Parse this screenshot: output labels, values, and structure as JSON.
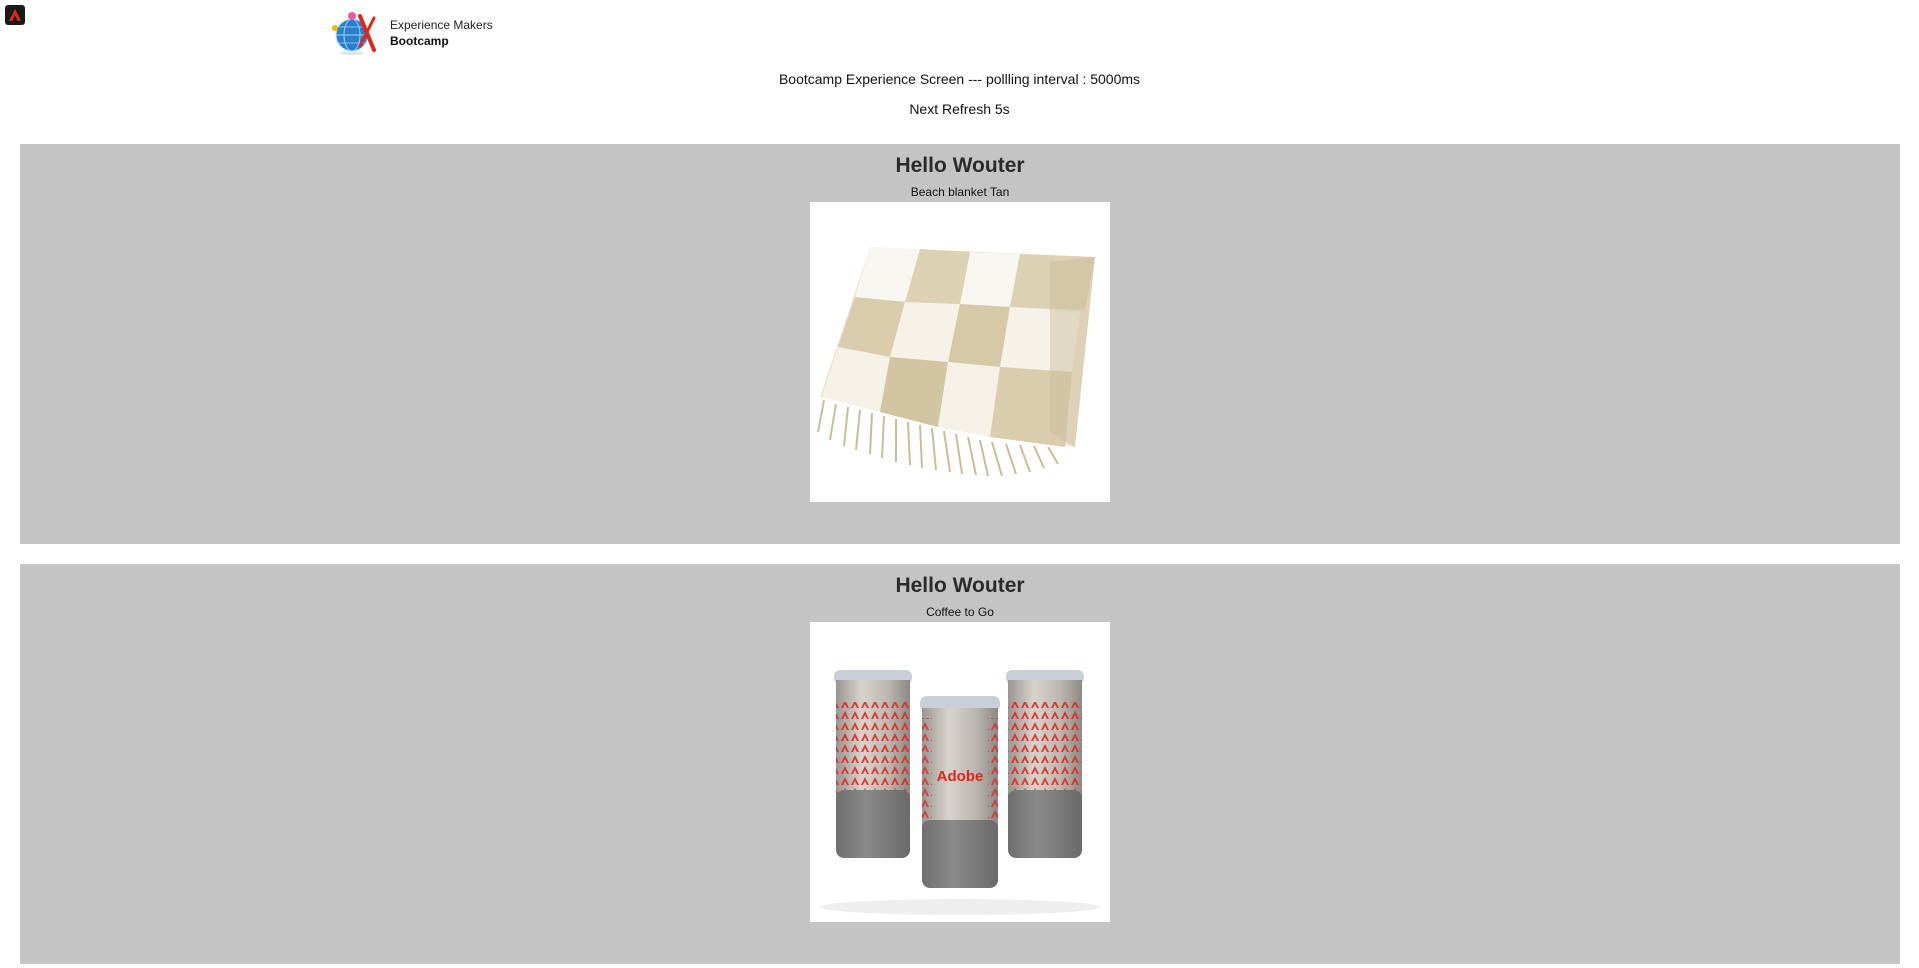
{
  "app": {
    "corner_icon": "adobe-app-icon"
  },
  "brand": {
    "line1": "Experience Makers",
    "line2": "Bootcamp",
    "logo_icon": "globe-logo-icon"
  },
  "status": {
    "screen_text": "Bootcamp Experience Screen --- pollling interval : 5000ms",
    "refresh_text": "Next Refresh 5s"
  },
  "cards": [
    {
      "greeting": "Hello Wouter",
      "product": "Beach blanket Tan",
      "image_icon": "beach-blanket-image"
    },
    {
      "greeting": "Hello Wouter",
      "product": "Coffee to Go",
      "image_icon": "coffee-tumblers-image",
      "image_text": "Adobe"
    }
  ],
  "colors": {
    "card_background": "#c4c4c4",
    "accent_red": "#e0261b"
  }
}
